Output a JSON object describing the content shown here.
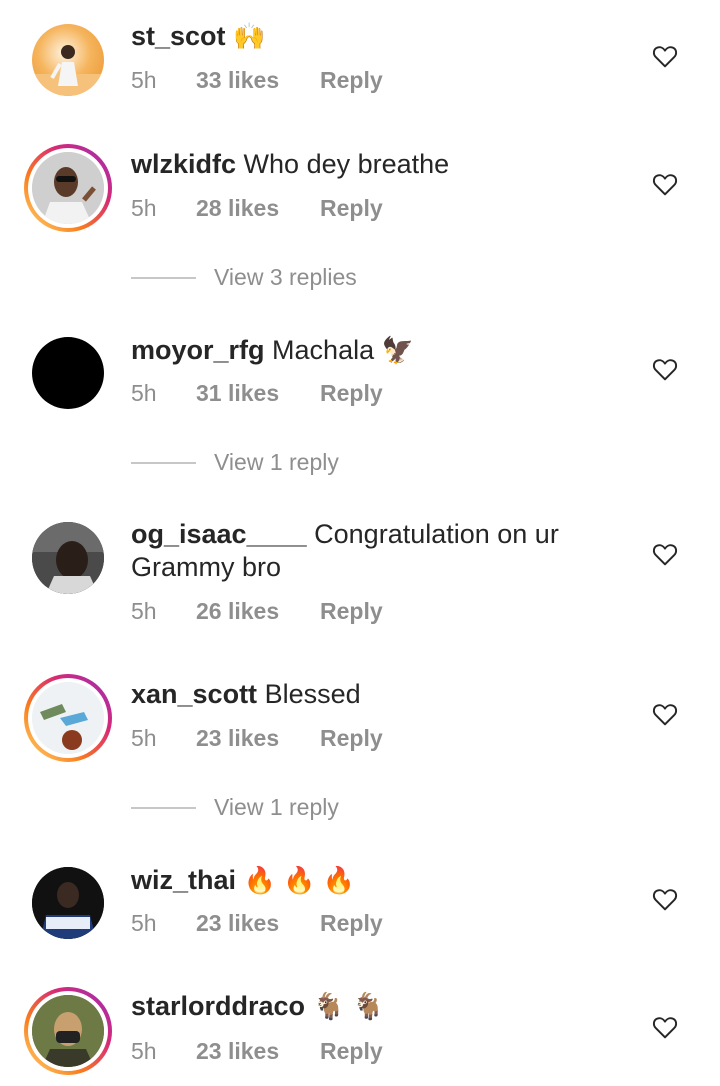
{
  "comments": [
    {
      "username": "st_scot",
      "text": "",
      "emoji": "🙌",
      "time": "5h",
      "likes": "33 likes",
      "reply": "Reply",
      "has_story": false
    },
    {
      "username": "wlzkidfc",
      "text": "Who dey breathe",
      "emoji": "",
      "time": "5h",
      "likes": "28 likes",
      "reply": "Reply",
      "has_story": true,
      "view_replies": "View 3 replies"
    },
    {
      "username": "moyor_rfg",
      "text": "Machala",
      "emoji": "🦅",
      "time": "5h",
      "likes": "31 likes",
      "reply": "Reply",
      "has_story": false,
      "view_replies": "View 1 reply"
    },
    {
      "username": "og_isaac____",
      "text": "Congratulation on ur Grammy bro",
      "emoji": "",
      "time": "5h",
      "likes": "26 likes",
      "reply": "Reply",
      "has_story": false
    },
    {
      "username": "xan_scott",
      "text": "Blessed",
      "emoji": "",
      "time": "5h",
      "likes": "23 likes",
      "reply": "Reply",
      "has_story": true,
      "view_replies": "View 1 reply"
    },
    {
      "username": "wiz_thai",
      "text": "",
      "emoji": "🔥 🔥 🔥",
      "time": "5h",
      "likes": "23 likes",
      "reply": "Reply",
      "has_story": false
    },
    {
      "username": "starlorddraco",
      "text": "",
      "emoji": "🐐 🐐",
      "time": "5h",
      "likes": "23 likes",
      "reply": "Reply",
      "has_story": true
    }
  ],
  "icons": {
    "like": "heart-outline-icon"
  },
  "colors": {
    "text": "#262626",
    "secondary": "#8e8e8e",
    "divider": "#c7c7c7"
  }
}
